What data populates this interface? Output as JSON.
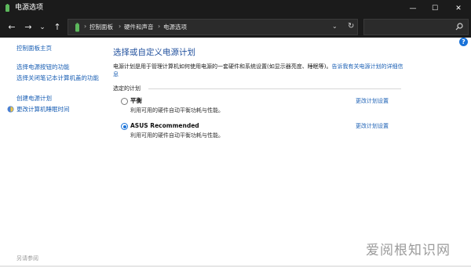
{
  "window": {
    "title": "电源选项",
    "buttons": {
      "minimize": "—",
      "maximize": "☐",
      "close": "✕"
    }
  },
  "nav": {
    "back": "←",
    "forward": "→",
    "recent": "⌄",
    "up": "↑",
    "breadcrumb": [
      "控制面板",
      "硬件和声音",
      "电源选项"
    ],
    "separator": "›",
    "dropdown": "⌄",
    "refresh": "↻",
    "search_placeholder": ""
  },
  "sidebar": {
    "items": [
      {
        "label": "控制面板主页"
      },
      {
        "label": "选择电源按钮的功能"
      },
      {
        "label": "选择关闭笔记本计算机盖的功能"
      },
      {
        "label": "创建电源计划"
      },
      {
        "label": "更改计算机睡眠时间"
      }
    ],
    "footer": "另请参阅"
  },
  "main": {
    "heading": "选择或自定义电源计划",
    "description": "电源计划是用于管理计算机如何使用电源的一套硬件和系统设置(如显示器亮度、睡眠等)。",
    "description_link": "告诉我有关电源计划的详细信息",
    "section_label": "选定的计划",
    "plans": [
      {
        "name": "平衡",
        "desc": "利用可用的硬件自动平衡功耗与性能。",
        "link": "更改计划设置",
        "selected": false
      },
      {
        "name": "ASUS Recommended",
        "desc": "利用可用的硬件自动平衡功耗与性能。",
        "link": "更改计划设置",
        "selected": true
      }
    ]
  },
  "help": "?",
  "watermark": "爱阅根知识网",
  "colors": {
    "accent": "#1a73d9",
    "link": "#1a5fb4",
    "heading": "#1e4e9c",
    "titlebar": "#1b1b1b"
  }
}
